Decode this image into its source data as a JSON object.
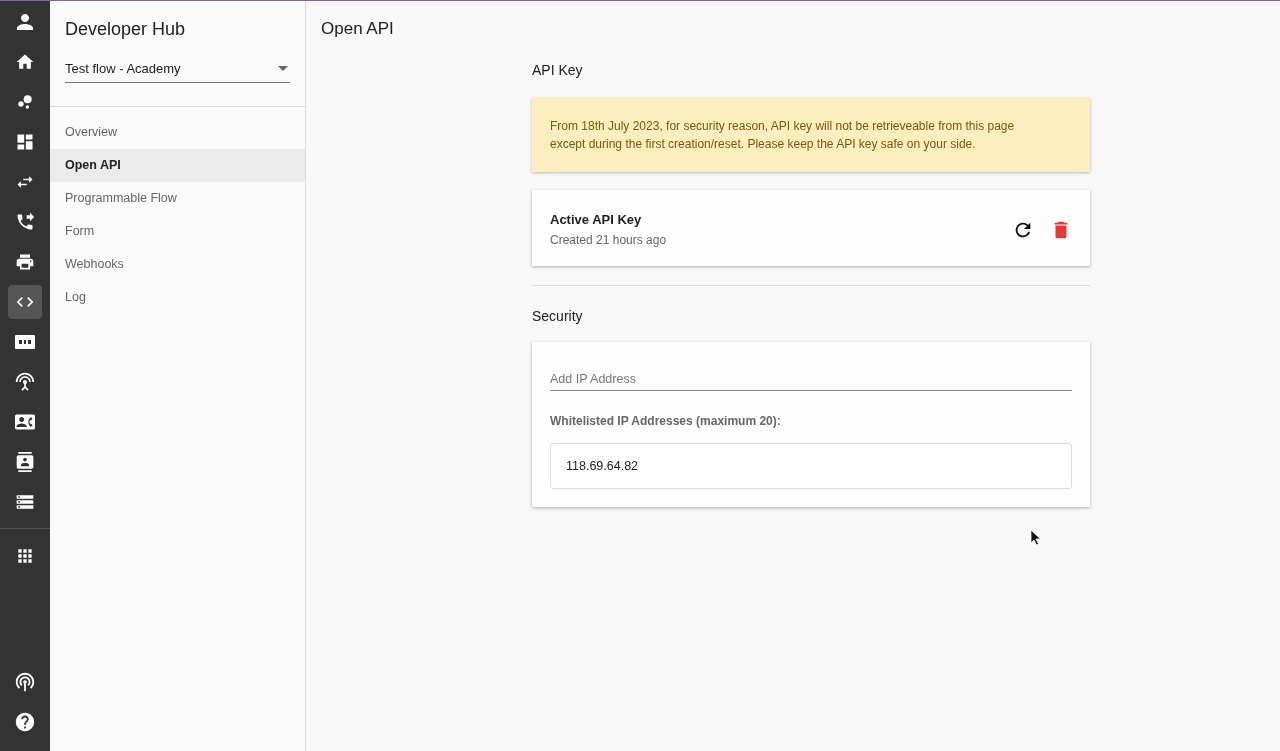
{
  "rail": {
    "items": [
      {
        "selected": false
      },
      {
        "selected": false
      },
      {
        "selected": false
      },
      {
        "selected": false
      },
      {
        "selected": false
      },
      {
        "selected": false
      },
      {
        "selected": false
      },
      {
        "selected": true
      },
      {
        "selected": false
      },
      {
        "selected": false
      },
      {
        "selected": false
      },
      {
        "selected": false
      },
      {
        "selected": false
      },
      {
        "selected": false
      }
    ],
    "bottom_items": [
      {
        "selected": false
      },
      {
        "selected": false
      }
    ]
  },
  "sidebar": {
    "title": "Developer Hub",
    "flow_select": {
      "value": "Test flow - Academy"
    },
    "items": [
      {
        "label": "Overview",
        "selected": false
      },
      {
        "label": "Open API",
        "selected": true
      },
      {
        "label": "Programmable Flow",
        "selected": false
      },
      {
        "label": "Form",
        "selected": false
      },
      {
        "label": "Webhooks",
        "selected": false
      },
      {
        "label": "Log",
        "selected": false
      }
    ]
  },
  "page": {
    "title": "Open API"
  },
  "api_key": {
    "heading": "API Key",
    "notice": "From 18th July 2023, for security reason, API key will not be retrieveable from this page except during the first creation/reset. Please keep the API key safe on your side.",
    "key_card": {
      "title": "Active API Key",
      "subtitle": "Created 21 hours ago"
    }
  },
  "security": {
    "heading": "Security",
    "ip_field": {
      "placeholder": "Add IP Address"
    },
    "whitelist_label": "Whitelisted IP Addresses (maximum 20):",
    "whitelist": [
      "118.69.64.82"
    ]
  }
}
